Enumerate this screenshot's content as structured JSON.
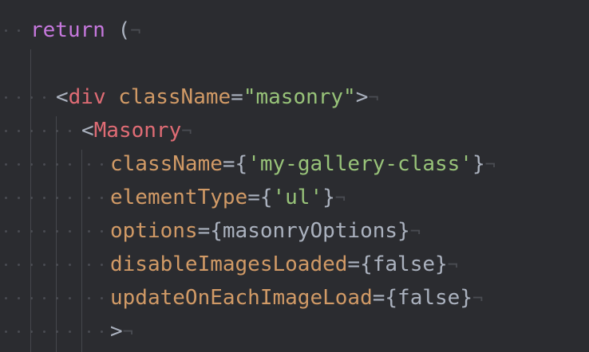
{
  "editor": {
    "lines": [
      {
        "tokens": [
          {
            "t": "return",
            "c": "kw"
          },
          {
            "t": " (",
            "c": "pn"
          }
        ]
      },
      {
        "tokens": []
      },
      {
        "tokens": [
          {
            "t": "<",
            "c": "pn"
          },
          {
            "t": "div",
            "c": "tg"
          },
          {
            "t": " ",
            "c": "pn"
          },
          {
            "t": "className",
            "c": "at"
          },
          {
            "t": "=",
            "c": "pn"
          },
          {
            "t": "\"masonry\"",
            "c": "st"
          },
          {
            "t": ">",
            "c": "pn"
          }
        ]
      },
      {
        "tokens": [
          {
            "t": "<",
            "c": "pn"
          },
          {
            "t": "Masonry",
            "c": "tg"
          }
        ]
      },
      {
        "tokens": [
          {
            "t": "className",
            "c": "at"
          },
          {
            "t": "={",
            "c": "pn"
          },
          {
            "t": "'my-gallery-class'",
            "c": "st"
          },
          {
            "t": "}",
            "c": "pn"
          }
        ]
      },
      {
        "tokens": [
          {
            "t": "elementType",
            "c": "at"
          },
          {
            "t": "={",
            "c": "pn"
          },
          {
            "t": "'ul'",
            "c": "st"
          },
          {
            "t": "}",
            "c": "pn"
          }
        ]
      },
      {
        "tokens": [
          {
            "t": "options",
            "c": "at"
          },
          {
            "t": "={",
            "c": "pn"
          },
          {
            "t": "masonryOptions",
            "c": "id"
          },
          {
            "t": "}",
            "c": "pn"
          }
        ]
      },
      {
        "tokens": [
          {
            "t": "disableImagesLoaded",
            "c": "at"
          },
          {
            "t": "={",
            "c": "pn"
          },
          {
            "t": "false",
            "c": "id"
          },
          {
            "t": "}",
            "c": "pn"
          }
        ]
      },
      {
        "tokens": [
          {
            "t": "updateOnEachImageLoad",
            "c": "at"
          },
          {
            "t": "={",
            "c": "pn"
          },
          {
            "t": "false",
            "c": "id"
          },
          {
            "t": "}",
            "c": "pn"
          }
        ]
      },
      {
        "tokens": [
          {
            "t": ">",
            "c": "pn"
          }
        ]
      }
    ],
    "eol_marker": "¬",
    "colors": {
      "background": "#2b2c30",
      "keyword": "#c678dd",
      "tag": "#e06c75",
      "attribute": "#d19a66",
      "string": "#98c379",
      "punctuation": "#abb2bf",
      "invisible": "#4a4c52"
    }
  }
}
